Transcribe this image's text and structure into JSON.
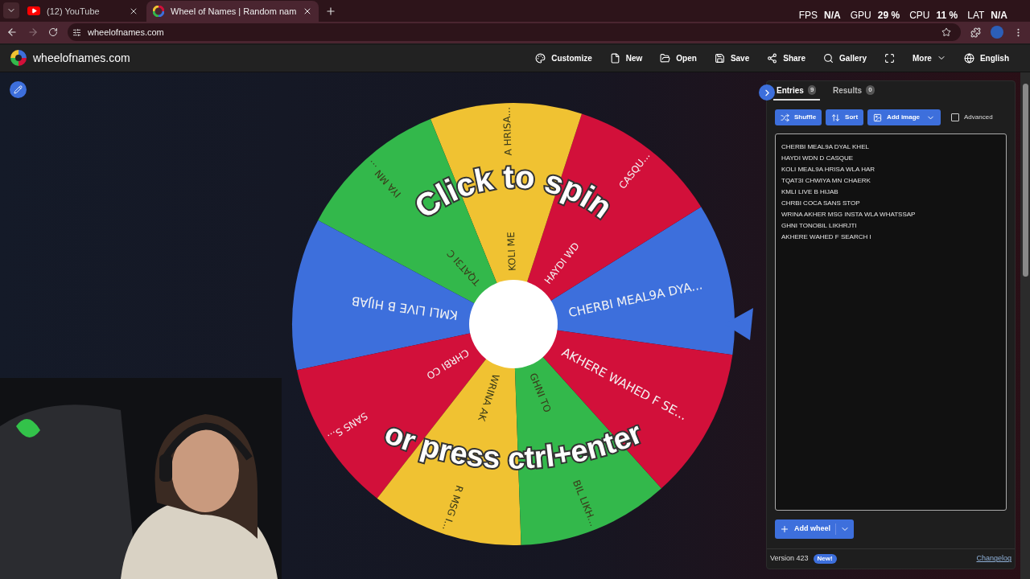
{
  "browser": {
    "tabs": [
      {
        "title": "(12) YouTube",
        "kind": "youtube",
        "selected": false
      },
      {
        "title": "Wheel of Names | Random nam",
        "kind": "wheel",
        "selected": true
      }
    ],
    "address": "wheelofnames.com"
  },
  "overlay_stats": [
    {
      "label": "FPS",
      "value": "N/A"
    },
    {
      "label": "GPU",
      "value": "29 %"
    },
    {
      "label": "CPU",
      "value": "11 %"
    },
    {
      "label": "LAT",
      "value": "N/A"
    }
  ],
  "site": {
    "logo_text": "wheelofnames.com",
    "menu": [
      {
        "label": "Customize",
        "kind": "link"
      },
      {
        "label": "New",
        "kind": "link"
      },
      {
        "label": "Open",
        "kind": "link"
      },
      {
        "label": "Save",
        "kind": "link"
      },
      {
        "label": "Share",
        "kind": "link"
      },
      {
        "label": "Gallery",
        "kind": "link"
      },
      {
        "kind": "icon"
      },
      {
        "label": "More",
        "kind": "dropdown"
      },
      {
        "label": "English",
        "kind": "link"
      }
    ]
  },
  "wheel": {
    "prompt": "Click to spin",
    "prompt_2": "or press ctrl+enter",
    "slices": [
      {
        "label": "CHERBI MEAL9A DYA...",
        "color": "#3d6fdc"
      },
      {
        "label_parts": [
          "HAYDI WD",
          "CASQU..."
        ],
        "color": "#d2103a"
      },
      {
        "label_parts": [
          "KOLI ME",
          "A HRISA..."
        ],
        "color": "#f0c232"
      },
      {
        "label_parts": [
          "TQAT3I C",
          "IYA MN ..."
        ],
        "color": "#33b84b"
      },
      {
        "label": "KMLI LIVE B HIJAB",
        "color": "#3d6fdc"
      },
      {
        "label_parts": [
          "CHRBI CO",
          "SANS S..."
        ],
        "color": "#d2103a"
      },
      {
        "label_parts": [
          "WRINA AK",
          "R MSG I..."
        ],
        "color": "#f0c232"
      },
      {
        "label_parts": [
          "GHNI TO",
          "BIL LIKH..."
        ],
        "color": "#33b84b"
      },
      {
        "label": "AKHERE WAHED F SE...",
        "color": "#d2103a"
      }
    ]
  },
  "panel": {
    "tabs": [
      {
        "label": "Entries",
        "count": "9",
        "selected": true
      },
      {
        "label": "Results",
        "count": "0",
        "selected": false
      }
    ],
    "buttons": [
      {
        "label": "Shuffle"
      },
      {
        "label": "Sort"
      },
      {
        "label": "Add image",
        "kind": "dropdown"
      }
    ],
    "advanced": {
      "label": "Advanced",
      "checked": false
    },
    "entries": [
      "CHERBI MEAL9A DYAL KHEL",
      "HAYDI WDN D CASQUE",
      "KOLI MEAL9A HRISA WLA HAR",
      "TQAT3I CHWIYA MN CHAERK",
      "KMLI LIVE B HIJAB",
      "CHRBI COCA SANS STOP",
      "WRINA AKHER MSG INSTA WLA WHATSSAP",
      "GHNI TONOBIL LIKHRJTI",
      "AKHERE WAHED F SEARCH I"
    ],
    "add_wheel": "Add wheel",
    "version": "Version 423",
    "badge": "New!",
    "link": "Changelog"
  }
}
